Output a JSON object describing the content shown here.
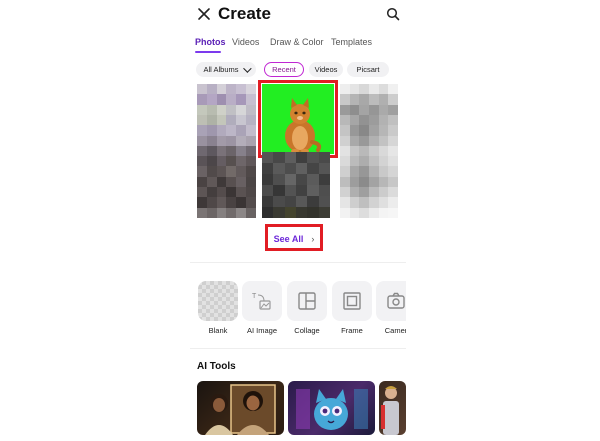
{
  "header": {
    "title": "Create",
    "close_icon": "close-icon",
    "search_icon": "search-icon"
  },
  "tabs": [
    {
      "label": "Photos",
      "active": true
    },
    {
      "label": "Videos",
      "active": false
    },
    {
      "label": "Draw & Color",
      "active": false
    },
    {
      "label": "Templates",
      "active": false
    }
  ],
  "filters": [
    {
      "label": "All Albums",
      "selected": false,
      "dropdown": true
    },
    {
      "label": "Recent",
      "selected": true
    },
    {
      "label": "Videos",
      "selected": false
    },
    {
      "label": "Picsart",
      "selected": false
    }
  ],
  "gallery": {
    "see_all_label": "See All",
    "see_all_icon": "chevron-right-icon"
  },
  "tools": [
    {
      "label": "Blank",
      "icon": "transparent-canvas-icon"
    },
    {
      "label": "AI Image",
      "icon": "ai-image-icon"
    },
    {
      "label": "Collage",
      "icon": "collage-icon"
    },
    {
      "label": "Frame",
      "icon": "frame-icon"
    },
    {
      "label": "Camer",
      "icon": "camera-icon"
    }
  ],
  "ai_tools": {
    "title": "AI Tools"
  },
  "colors": {
    "accent": "#7c3aed",
    "highlight_box": "#e11d24",
    "green_screen": "#22ee22"
  }
}
